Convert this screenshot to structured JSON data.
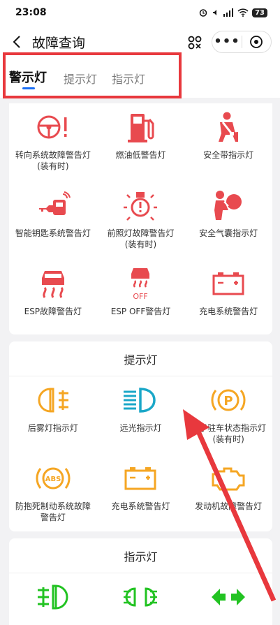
{
  "status": {
    "time": "23:08",
    "battery": "73"
  },
  "nav": {
    "title": "故障查询"
  },
  "tabs": [
    {
      "label": "警示灯"
    },
    {
      "label": "提示灯"
    },
    {
      "label": "指示灯"
    }
  ],
  "warning": {
    "items": [
      {
        "label": "转向系统故障警告灯(装有时)",
        "icon": "steering-warning-icon"
      },
      {
        "label": "燃油低警告灯",
        "icon": "fuel-pump-icon"
      },
      {
        "label": "安全带指示灯",
        "icon": "seatbelt-icon"
      },
      {
        "label": "智能钥匙系统警告灯",
        "icon": "smart-key-icon"
      },
      {
        "label": "前照灯故障警告灯(装有时)",
        "icon": "headlight-fault-icon"
      },
      {
        "label": "安全气囊指示灯",
        "icon": "airbag-icon"
      },
      {
        "label": "ESP故障警告灯",
        "icon": "esp-icon"
      },
      {
        "label": "ESP OFF警告灯",
        "icon": "esp-off-icon"
      },
      {
        "label": "充电系统警告灯",
        "icon": "battery-icon"
      }
    ],
    "esp_off_text": "OFF"
  },
  "hint": {
    "title": "提示灯",
    "items": [
      {
        "label": "后雾灯指示灯",
        "icon": "rear-fog-icon"
      },
      {
        "label": "远光指示灯",
        "icon": "high-beam-icon"
      },
      {
        "label": "电子驻车状态指示灯(装有时)",
        "icon": "parking-brake-icon"
      },
      {
        "label": "防抱死制动系统故障警告灯",
        "icon": "abs-icon"
      },
      {
        "label": "充电系统警告灯",
        "icon": "battery-icon"
      },
      {
        "label": "发动机故障警告灯",
        "icon": "engine-icon"
      }
    ],
    "abs_text": "ABS",
    "p_text": "P"
  },
  "indicator": {
    "title": "指示灯"
  },
  "colors": {
    "red": "#e84a4f",
    "orange": "#f5a623",
    "teal": "#1aa7c8",
    "green": "#22c322",
    "accent": "#1a6ef5",
    "highlight": "#e8383d"
  }
}
